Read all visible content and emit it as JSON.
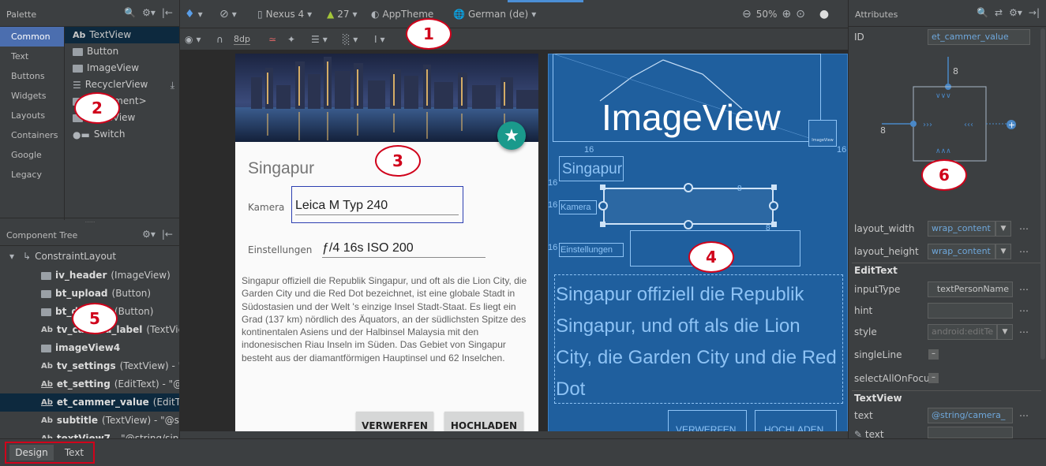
{
  "palette": {
    "title": "Palette",
    "categories": [
      "Common",
      "Text",
      "Buttons",
      "Widgets",
      "Layouts",
      "Containers",
      "Google",
      "Legacy"
    ],
    "items": [
      {
        "label": "TextView",
        "prefix": "Ab"
      },
      {
        "label": "Button"
      },
      {
        "label": "ImageView"
      },
      {
        "label": "RecyclerView"
      },
      {
        "label": "<fragment>"
      },
      {
        "label": "ScrollView"
      },
      {
        "label": "Switch"
      }
    ]
  },
  "component_tree": {
    "title": "Component Tree",
    "root": "ConstraintLayout",
    "items": [
      {
        "id": "iv_header",
        "type": "(ImageView)"
      },
      {
        "id": "bt_upload",
        "type": "(Button)"
      },
      {
        "id": "bt_discard",
        "type": "(Button)"
      },
      {
        "id": "tv_camera_label",
        "type": "(TextView)"
      },
      {
        "id": "imageView4",
        "type": ""
      },
      {
        "id": "tv_settings",
        "type": "(TextView) - \"@"
      },
      {
        "id": "et_setting",
        "type": "(EditText) - \"@st"
      },
      {
        "id": "et_cammer_value",
        "type": "(EditText"
      },
      {
        "id": "subtitle",
        "type": "(TextView) - \"@string"
      },
      {
        "id": "textView7",
        "type": "- \"@string/singa"
      }
    ]
  },
  "toolbar": {
    "device": "Nexus 4",
    "api": "27",
    "theme": "AppTheme",
    "locale": "German (de)",
    "zoom": "50%",
    "margin": "8dp"
  },
  "design": {
    "title": "Singapur",
    "camera_label": "Kamera",
    "camera_value": "Leica M Typ 240",
    "settings_label": "Einstellungen",
    "settings_value": "ƒ/4 16s ISO 200",
    "body": "Singapur offiziell die Republik Singapur, und oft als die Lion City, die Garden City und die Red Dot bezeichnet, ist eine globale Stadt in Südostasien und der Welt 's einzige Insel Stadt-Staat. Es liegt ein Grad (137 km) nördlich des Äquators, an der südlichsten Spitze des kontinentalen Asiens und der Halbinsel Malaysia mit den indonesischen Riau Inseln im Süden. Das Gebiet von Singapur besteht aus der diamantförmigen Hauptinsel und 62 Inselchen.",
    "discard": "VERWERFEN",
    "upload": "HOCHLADEN"
  },
  "blueprint": {
    "imageview": "ImageView",
    "imageview_small": "ImageView",
    "title": "Singapur",
    "camera_label": "Kamera",
    "settings_label": "Einstellungen",
    "body": "Singapur offiziell die Republik Singapur, und oft als die Lion City, die Garden City und die Red Dot",
    "discard": "VERWERFEN",
    "upload": "HOCHLADEN",
    "margin16": "16",
    "margin8": "8"
  },
  "attributes": {
    "title": "Attributes",
    "id_label": "ID",
    "id_value": "et_cammer_value",
    "margin_top": "8",
    "margin_left": "8",
    "layout_width_label": "layout_width",
    "layout_width_value": "wrap_content",
    "layout_height_label": "layout_height",
    "layout_height_value": "wrap_content",
    "edittext_section": "EditText",
    "inputType_label": "inputType",
    "inputType_value": "textPersonName",
    "hint_label": "hint",
    "hint_value": "",
    "style_label": "style",
    "style_value": "android:editTe",
    "singleLine_label": "singleLine",
    "selectAll_label": "selectAllOnFocu",
    "textview_section": "TextView",
    "text_label": "text",
    "text_value": "@string/camera_",
    "text2_label": "text"
  },
  "bottom_tabs": [
    "Design",
    "Text"
  ],
  "callouts": [
    "1",
    "2",
    "3",
    "4",
    "5",
    "6"
  ],
  "colors": {
    "accent": "#4b6eaf",
    "callout": "#d0021b",
    "blueprint": "#1f5f9e",
    "fab": "#1a9a8c"
  }
}
